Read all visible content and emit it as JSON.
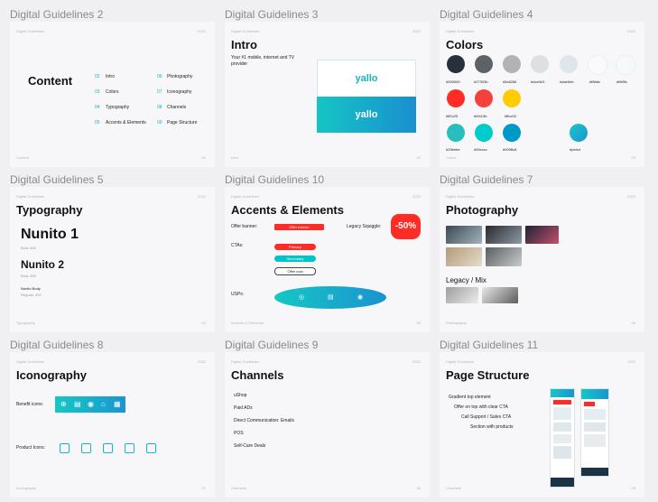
{
  "frames": {
    "f2": {
      "title": "Digital Guidelines 2",
      "brand": "Digital Guidelines",
      "year": "2022",
      "heading": "Content",
      "footer_label": "Content",
      "page": "01",
      "toc": [
        {
          "n": "02",
          "label": "Intro"
        },
        {
          "n": "03",
          "label": "Colors"
        },
        {
          "n": "04",
          "label": "Typography"
        },
        {
          "n": "05",
          "label": "Accents & Elements"
        },
        {
          "n": "06",
          "label": "Photography"
        },
        {
          "n": "07",
          "label": "Iconography"
        },
        {
          "n": "08",
          "label": "Channels"
        },
        {
          "n": "09",
          "label": "Page Structure"
        }
      ]
    },
    "f3": {
      "title": "Digital Guidelines 3",
      "brand": "Digital Guidelines",
      "year": "2022",
      "heading": "Intro",
      "tagline": "Your #1 mobile, internet and TV provider",
      "logo_text": "yallo",
      "footer_label": "Intro",
      "page": "02"
    },
    "f4": {
      "title": "Digital Guidelines 4",
      "brand": "Digital Guidelines",
      "year": "2022",
      "heading": "Colors",
      "footer_label": "Colors",
      "page": "03",
      "swatches": [
        {
          "hex": "#000000",
          "color": "#27303b"
        },
        {
          "hex": "#27303b",
          "color": "#5c6266"
        },
        {
          "hex": "#5c6266",
          "color": "#b0b2b5"
        },
        {
          "hex": "#dce0e3",
          "color": "#dce0e3"
        },
        {
          "hex": "#dae5eb",
          "color": "#dee6ec"
        },
        {
          "hex": "#f8fafc",
          "color": "#f8fafc"
        },
        {
          "hex": "#f6f9fc",
          "color": "#f6f9fc"
        },
        {
          "hex": "#ff2c25",
          "color": "#ff2c25"
        },
        {
          "hex": "#f4413b",
          "color": "#f4413b"
        },
        {
          "hex": "#ffcc00",
          "color": "#ffcc00"
        },
        {
          "hex": "#29bebe",
          "color": "#29bebe"
        },
        {
          "hex": "#00cccc",
          "color": "#00cccc"
        },
        {
          "hex": "#0098c8",
          "color": "#0098c8"
        },
        {
          "hex": "#petrol",
          "color": "#13a4c0"
        }
      ]
    },
    "f5": {
      "title": "Digital Guidelines 5",
      "brand": "Digital Guidelines",
      "year": "2022",
      "heading": "Typography",
      "footer_label": "Typography",
      "page": "04",
      "font1": "Nunito 1",
      "font1_sub": "Bold, 800",
      "font2": "Nunito 2",
      "font2_sub": "Bold, 800",
      "font3": "Nunito Body",
      "font3_sub": "Regular, 400"
    },
    "f10": {
      "title": "Digital Guidelines 10",
      "brand": "Digital Guidelines",
      "year": "2022",
      "heading": "Accents & Elements",
      "footer_label": "Accents & Elements",
      "page": "05",
      "offer_label": "Offer banner:",
      "offer_btn": "Offer banner",
      "squiggle_label": "Legacy Squiggle:",
      "squiggle_value": "-50%",
      "ctas_label": "CTAs:",
      "cta_primary": "Primary",
      "cta_secondary": "Secondary",
      "cta_offer": "Offer now",
      "usps_label": "USPs:"
    },
    "f7": {
      "title": "Digital Guidelines 7",
      "brand": "Digital Guidelines",
      "year": "2022",
      "heading": "Photography",
      "legacy": "Legacy / Mix",
      "footer_label": "Photography",
      "page": "06"
    },
    "f8": {
      "title": "Digital Guidelines 8",
      "brand": "Digital Guidelines",
      "year": "2022",
      "heading": "Iconography",
      "benefit": "Benefit icons:",
      "product": "Product Icons:",
      "footer_label": "Iconography",
      "page": "07"
    },
    "f9": {
      "title": "Digital Guidelines 9",
      "brand": "Digital Guidelines",
      "year": "2022",
      "heading": "Channels",
      "footer_label": "Channels",
      "page": "08",
      "channels": [
        "uShop",
        "Paid ADs",
        "Direct Communication: Emails",
        "POS",
        "Self-Care Deals"
      ]
    },
    "f11": {
      "title": "Digital Guidelines 11",
      "brand": "Digital Guidelines",
      "year": "2022",
      "heading": "Page Structure",
      "footer_label": "Channels",
      "page": "09",
      "items": [
        "Gradient top element",
        "Offer on top with clear CTA",
        "Call Support / Sales CTA",
        "Section with products"
      ]
    }
  }
}
